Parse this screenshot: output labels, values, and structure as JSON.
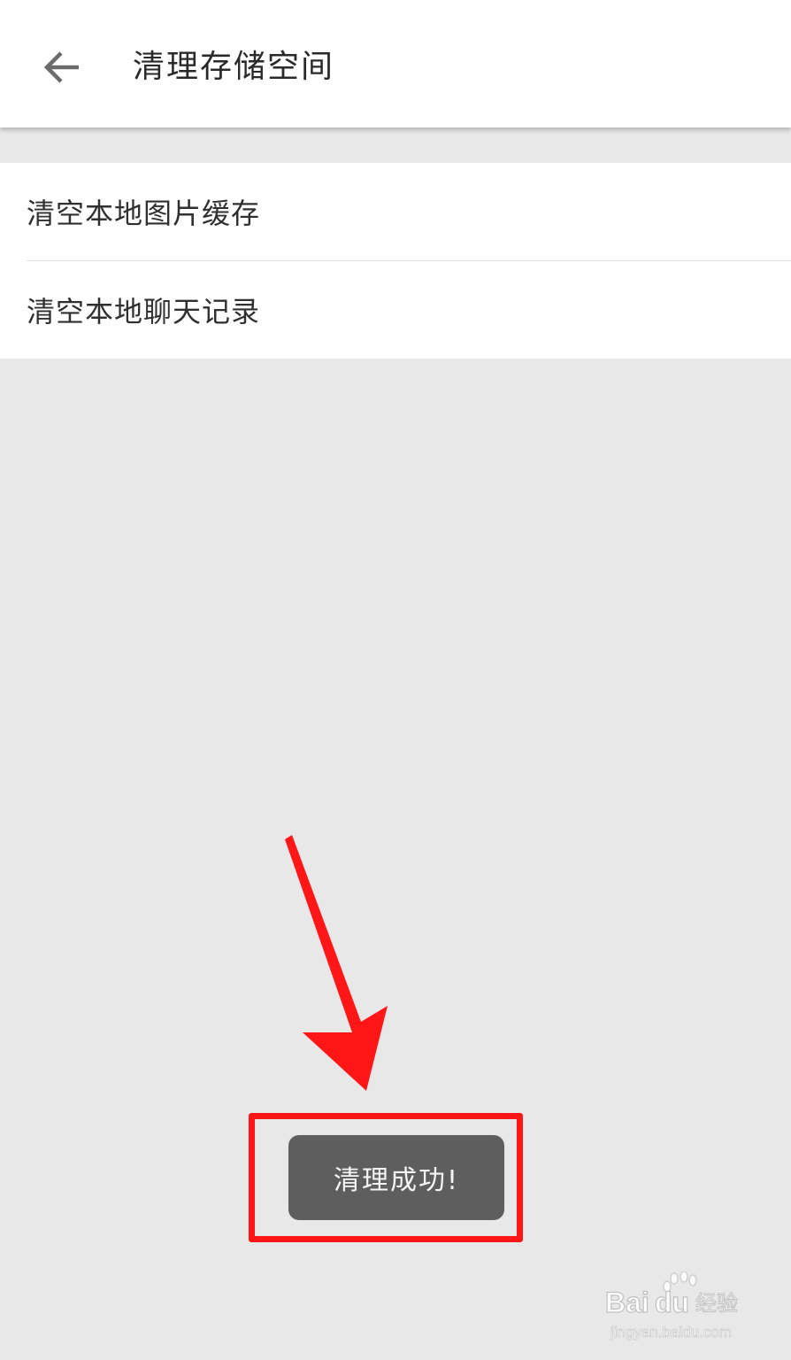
{
  "header": {
    "title": "清理存储空间",
    "back_icon": "arrow-left-icon"
  },
  "settings": {
    "items": [
      {
        "label": "清空本地图片缓存"
      },
      {
        "label": "清空本地聊天记录"
      }
    ]
  },
  "toast": {
    "message": "清理成功!"
  },
  "annotation": {
    "arrow_color": "#ff1616",
    "highlight_color": "#ff1616"
  },
  "watermark": {
    "brand": "Baidu经验",
    "url": "jingyan.baidu.com"
  },
  "colors": {
    "background": "#e9e8e9",
    "surface": "#ffffff",
    "toast_bg": "#5e5e5e"
  }
}
